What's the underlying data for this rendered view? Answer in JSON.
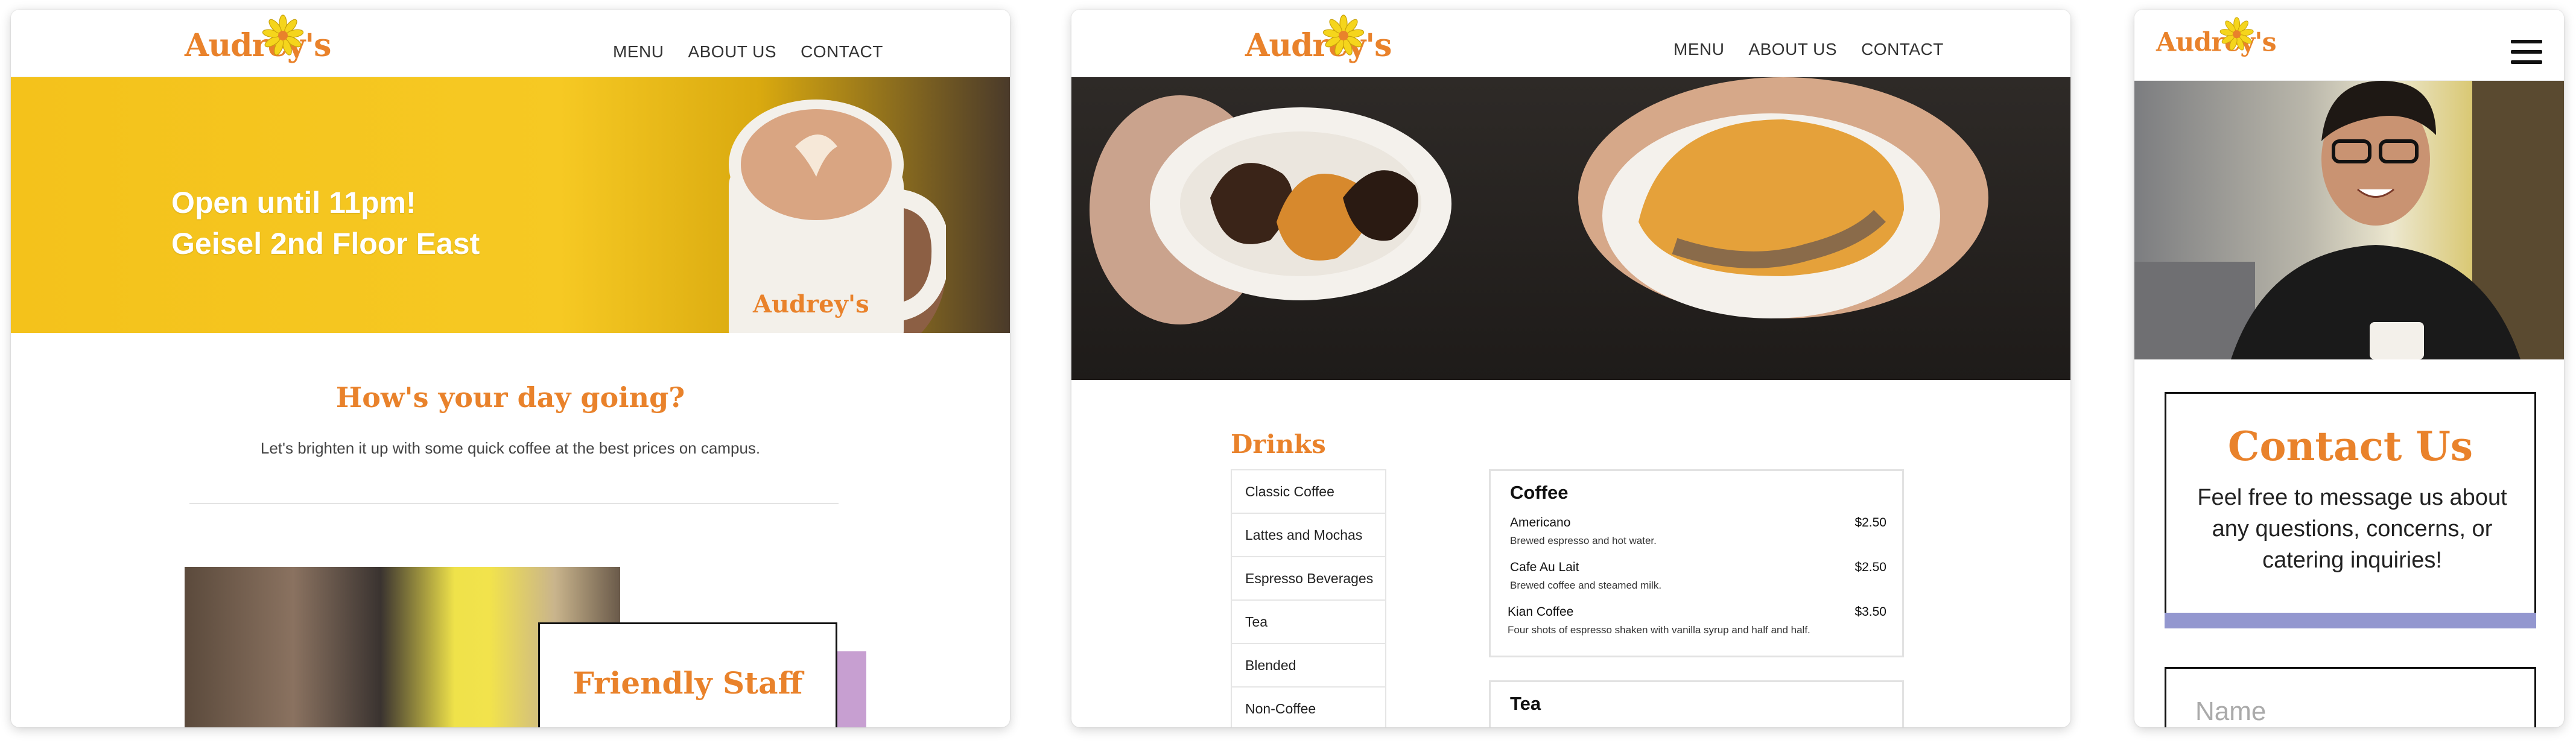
{
  "brand": {
    "logo_text": "Audrey's",
    "accent": "#e9822b",
    "purple": "#c79fd1"
  },
  "nav": {
    "items": [
      "MENU",
      "ABOUT US",
      "CONTACT"
    ]
  },
  "home": {
    "hero_line1": "Open until 11pm!",
    "hero_line2": "Geisel 2nd Floor East",
    "heading": "How's your day going?",
    "subtext": "Let's brighten it up with some quick coffee at the best prices on campus.",
    "staff_card_title": "Friendly Staff"
  },
  "menu": {
    "drinks_title": "Drinks",
    "categories": [
      "Classic Coffee",
      "Lattes and Mochas",
      "Espresso Beverages",
      "Tea",
      "Blended",
      "Non-Coffee"
    ],
    "coffee": {
      "title": "Coffee",
      "items": [
        {
          "name": "Americano",
          "price": "$2.50",
          "desc": "Brewed espresso and hot water."
        },
        {
          "name": "Cafe Au Lait",
          "price": "$2.50",
          "desc": "Brewed coffee and steamed milk."
        },
        {
          "name": "Kian Coffee",
          "price": "$3.50",
          "desc": "Four shots of espresso shaken with vanilla syrup and half and half."
        }
      ]
    },
    "tea": {
      "title": "Tea"
    }
  },
  "contact": {
    "title": "Contact Us",
    "text": "Feel free to message us about any questions, concerns, or catering inquiries!",
    "name_placeholder": "Name",
    "bar_color": "#9397cf"
  }
}
